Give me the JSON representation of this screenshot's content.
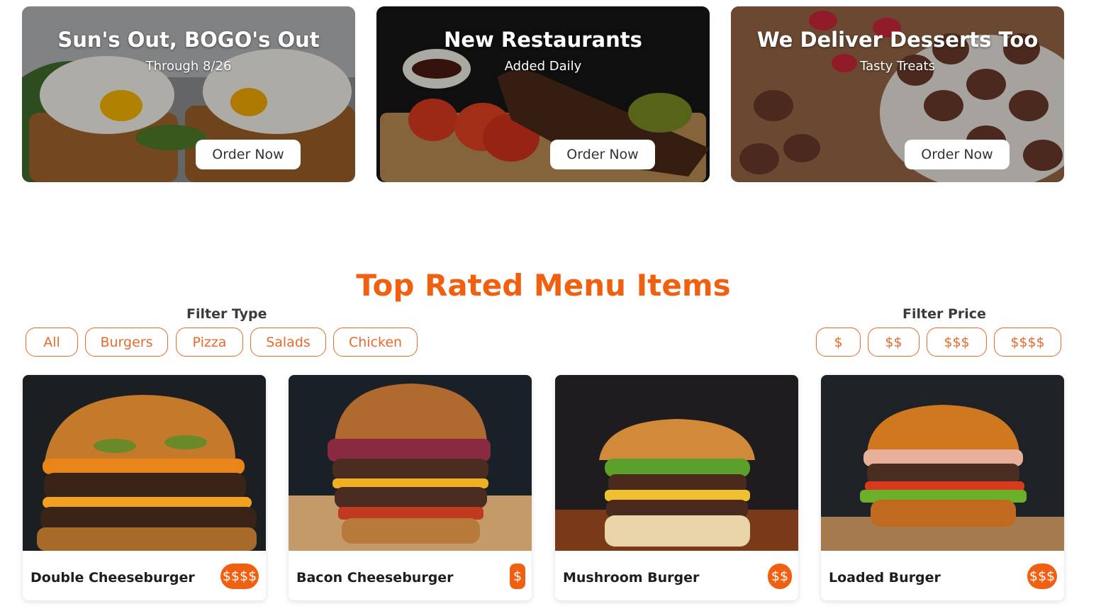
{
  "promos": [
    {
      "title": "Sun's Out, BOGO's Out",
      "subtitle": "Through 8/26",
      "button": "Order Now"
    },
    {
      "title": "New Restaurants",
      "subtitle": "Added Daily",
      "button": "Order Now"
    },
    {
      "title": "We Deliver Desserts Too",
      "subtitle": "Tasty Treats",
      "button": "Order Now"
    }
  ],
  "section": {
    "title": "Top Rated Menu Items",
    "filter_type_label": "Filter Type",
    "filter_price_label": "Filter Price",
    "type_filters": [
      "All",
      "Burgers",
      "Pizza",
      "Salads",
      "Chicken"
    ],
    "price_filters": [
      "$",
      "$$",
      "$$$",
      "$$$$"
    ]
  },
  "menu_items": [
    {
      "name": "Double Cheeseburger",
      "price": "$$$$"
    },
    {
      "name": "Bacon Cheeseburger",
      "price": "$"
    },
    {
      "name": "Mushroom Burger",
      "price": "$$"
    },
    {
      "name": "Loaded Burger",
      "price": "$$$"
    }
  ],
  "colors": {
    "accent": "#f06010",
    "chip_border": "#ea6a2a"
  }
}
